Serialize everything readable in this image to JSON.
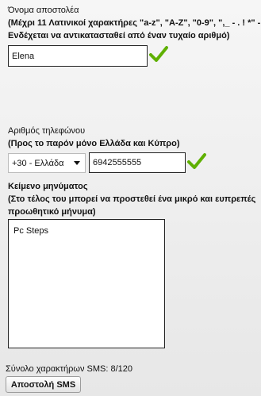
{
  "sender": {
    "title": "Όνομα αποστολέα",
    "hint_line1": "(Μέχρι 11 Λατινικοί χαρακτήρες \"a-z\", \"A-Z\", \"0-9\", \",_ - . ! *\" -",
    "hint_line2": "Ενδέχεται να αντικατασταθεί από έναν τυχαίο αριθμό)",
    "value": "Elena",
    "valid_icon": "checkmark-icon"
  },
  "phone": {
    "title": "Αριθμός τηλεφώνου",
    "hint": "(Προς το παρόν μόνο Ελλάδα και Κύπρο)",
    "country_selected": "+30 - Ελλάδα",
    "number": "6942555555",
    "valid_icon": "checkmark-icon"
  },
  "message": {
    "title": "Κείμενο μηνύματος",
    "hint_line1": "(Στο τέλος του μπορεί να προστεθεί ένα μικρό και ευπρεπές",
    "hint_line2": "προωθητικό μήνυμα)",
    "value": "Pc Steps"
  },
  "footer": {
    "counter": "Σύνολο χαρακτήρων SMS: 8/120",
    "send_label": "Αποστολή SMS"
  },
  "colors": {
    "check_green": "#5fb000"
  }
}
